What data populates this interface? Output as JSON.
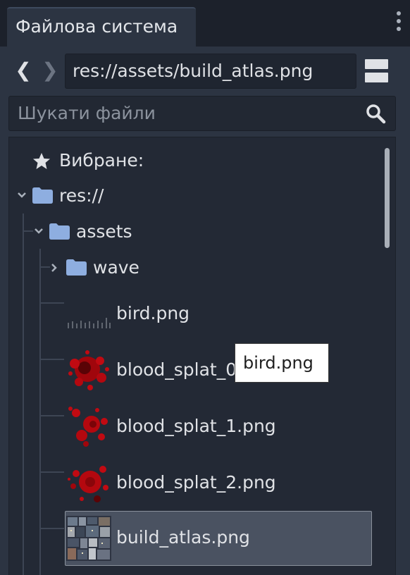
{
  "dock": {
    "tab_label": "Файлова система",
    "menu_icon": "vertical-dots-icon"
  },
  "navigation": {
    "back_icon": "chevron-left-icon",
    "forward_icon": "chevron-right-icon",
    "path": "res://assets/build_atlas.png",
    "layout_icon": "split-layout-icon"
  },
  "search": {
    "placeholder": "Шукати файли",
    "icon": "search-icon"
  },
  "tree": {
    "favorites": "Вибране:",
    "root": "res://",
    "assets": "assets",
    "wave": "wave",
    "files": [
      {
        "name": "bird.png",
        "thumbnail": "bird-sprite-strip"
      },
      {
        "name": "blood_splat_0.png",
        "thumbnail": "red-blood-splat"
      },
      {
        "name": "blood_splat_1.png",
        "thumbnail": "red-blood-splat"
      },
      {
        "name": "blood_splat_2.png",
        "thumbnail": "red-blood-splat"
      },
      {
        "name": "build_atlas.png",
        "thumbnail": "building-tiles-atlas"
      }
    ],
    "selected": "build_atlas.png"
  },
  "tooltip": "bird.png",
  "colors": {
    "panel_bg": "#2c3442",
    "tree_bg": "#232935",
    "folder": "#8eaee0",
    "selection": "#4a5261",
    "blood": "#b4080f"
  }
}
